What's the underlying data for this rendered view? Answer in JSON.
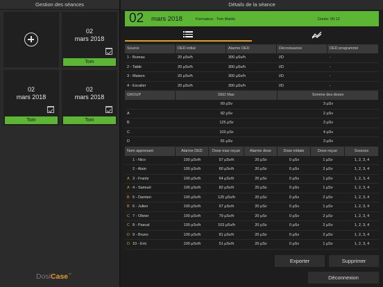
{
  "left": {
    "title": "Gestion des séances",
    "sessions": [
      {
        "date": "02\nmars 2018",
        "trainer": "Tom"
      },
      {
        "date": "02\nmars 2018",
        "trainer": "Tom"
      },
      {
        "date": "02\nmars 2018",
        "trainer": "Tom"
      }
    ],
    "logo_a": "Dosi",
    "logo_b": "Case",
    "logo_tm": "™"
  },
  "right": {
    "title": "Détails de la séance",
    "banner": {
      "day": "02",
      "month": "mars 2018",
      "trainer": "Formateur : Tom Martin",
      "duration": "Durée: 00:12"
    }
  },
  "colors": {
    "accent": "#5cb633",
    "tab_active": "#e0a21e",
    "logo": "#e09a2e"
  },
  "icons": {
    "add": "plus-circle-icon",
    "calendar": "calendar-check-icon",
    "list": "list-icon",
    "chart": "line-chart-icon"
  },
  "sources_table": {
    "headers": [
      "Source",
      "DED initial",
      "Alarme DED",
      "Décroissance",
      "DED programmé"
    ],
    "rows": [
      [
        "1 - Bureau",
        "20 µSv/h",
        "300 µSv/h",
        "I/D",
        "-"
      ],
      [
        "2 - Table",
        "20 µSv/h",
        "300 µSv/h",
        "I/D",
        "-"
      ],
      [
        "3 - Maison",
        "20 µSv/h",
        "300 µSv/h",
        "I/D",
        "-"
      ],
      [
        "4 - Escalier",
        "20 µSv/h",
        "300 µSv/h",
        "I/D",
        "-"
      ]
    ]
  },
  "group_table": {
    "headers": [
      "GROUP",
      "DED Max",
      "Somme des doses"
    ],
    "rows": [
      [
        "",
        "60 µSv",
        "3 µSv"
      ],
      [
        "A",
        "82 µSv",
        "2 µSv"
      ],
      [
        "B",
        "125 µSv",
        "3 µSv"
      ],
      [
        "C",
        "103 µSv",
        "4 µSv"
      ],
      [
        "D",
        "81 µSv",
        "3 µSv"
      ]
    ]
  },
  "learners_table": {
    "headers": [
      "Nom apprenant",
      "Alarme DED",
      "Dose max reçue",
      "Alarme dose",
      "Dose initiale",
      "Dose reçue",
      "Sources"
    ],
    "rows": [
      [
        "",
        "1 - Nico",
        "100 µSv/h",
        "57 µSv/h",
        "20 µSv",
        "0 µSv",
        "1 µSv",
        "1, 2, 3, 4"
      ],
      [
        "",
        "2 - Alain",
        "100 µSv/h",
        "60 µSv/h",
        "20 µSv",
        "0 µSv",
        "2 µSv",
        "1, 2, 3, 4"
      ],
      [
        "A",
        "3 - Frantz",
        "100 µSv/h",
        "64 µSv/h",
        "20 µSv",
        "0 µSv",
        "1 µSv",
        "1, 2, 3, 4"
      ],
      [
        "A",
        "4 - Samuel",
        "100 µSv/h",
        "82 µSv/h",
        "20 µSv",
        "0 µSv",
        "1 µSv",
        "1, 2, 3, 4"
      ],
      [
        "B",
        "5 - Damien",
        "100 µSv/h",
        "125 µSv/h",
        "20 µSv",
        "0 µSv",
        "2 µSv",
        "1, 2, 3, 4"
      ],
      [
        "B",
        "6 - Julien",
        "100 µSv/h",
        "67 µSv/h",
        "20 µSv",
        "0 µSv",
        "1 µSv",
        "1, 2, 3, 4"
      ],
      [
        "C",
        "7 - Olivier",
        "100 µSv/h",
        "79 µSv/h",
        "20 µSv",
        "0 µSv",
        "2 µSv",
        "1, 2, 3, 4"
      ],
      [
        "C",
        "8 - Pascal",
        "100 µSv/h",
        "103 µSv/h",
        "20 µSv",
        "0 µSv",
        "2 µSv",
        "1, 2, 3, 4"
      ],
      [
        "D",
        "9 - Bruno",
        "100 µSv/h",
        "81 µSv/h",
        "20 µSv",
        "0 µSv",
        "2 µSv",
        "1, 2, 3, 4"
      ],
      [
        "D",
        "10 - Eric",
        "100 µSv/h",
        "51 µSv/h",
        "20 µSv",
        "0 µSv",
        "1 µSv",
        "1, 2, 3, 4"
      ]
    ]
  },
  "buttons": {
    "export": "Exporter",
    "delete": "Supprimer",
    "logout": "Déconnexion"
  }
}
